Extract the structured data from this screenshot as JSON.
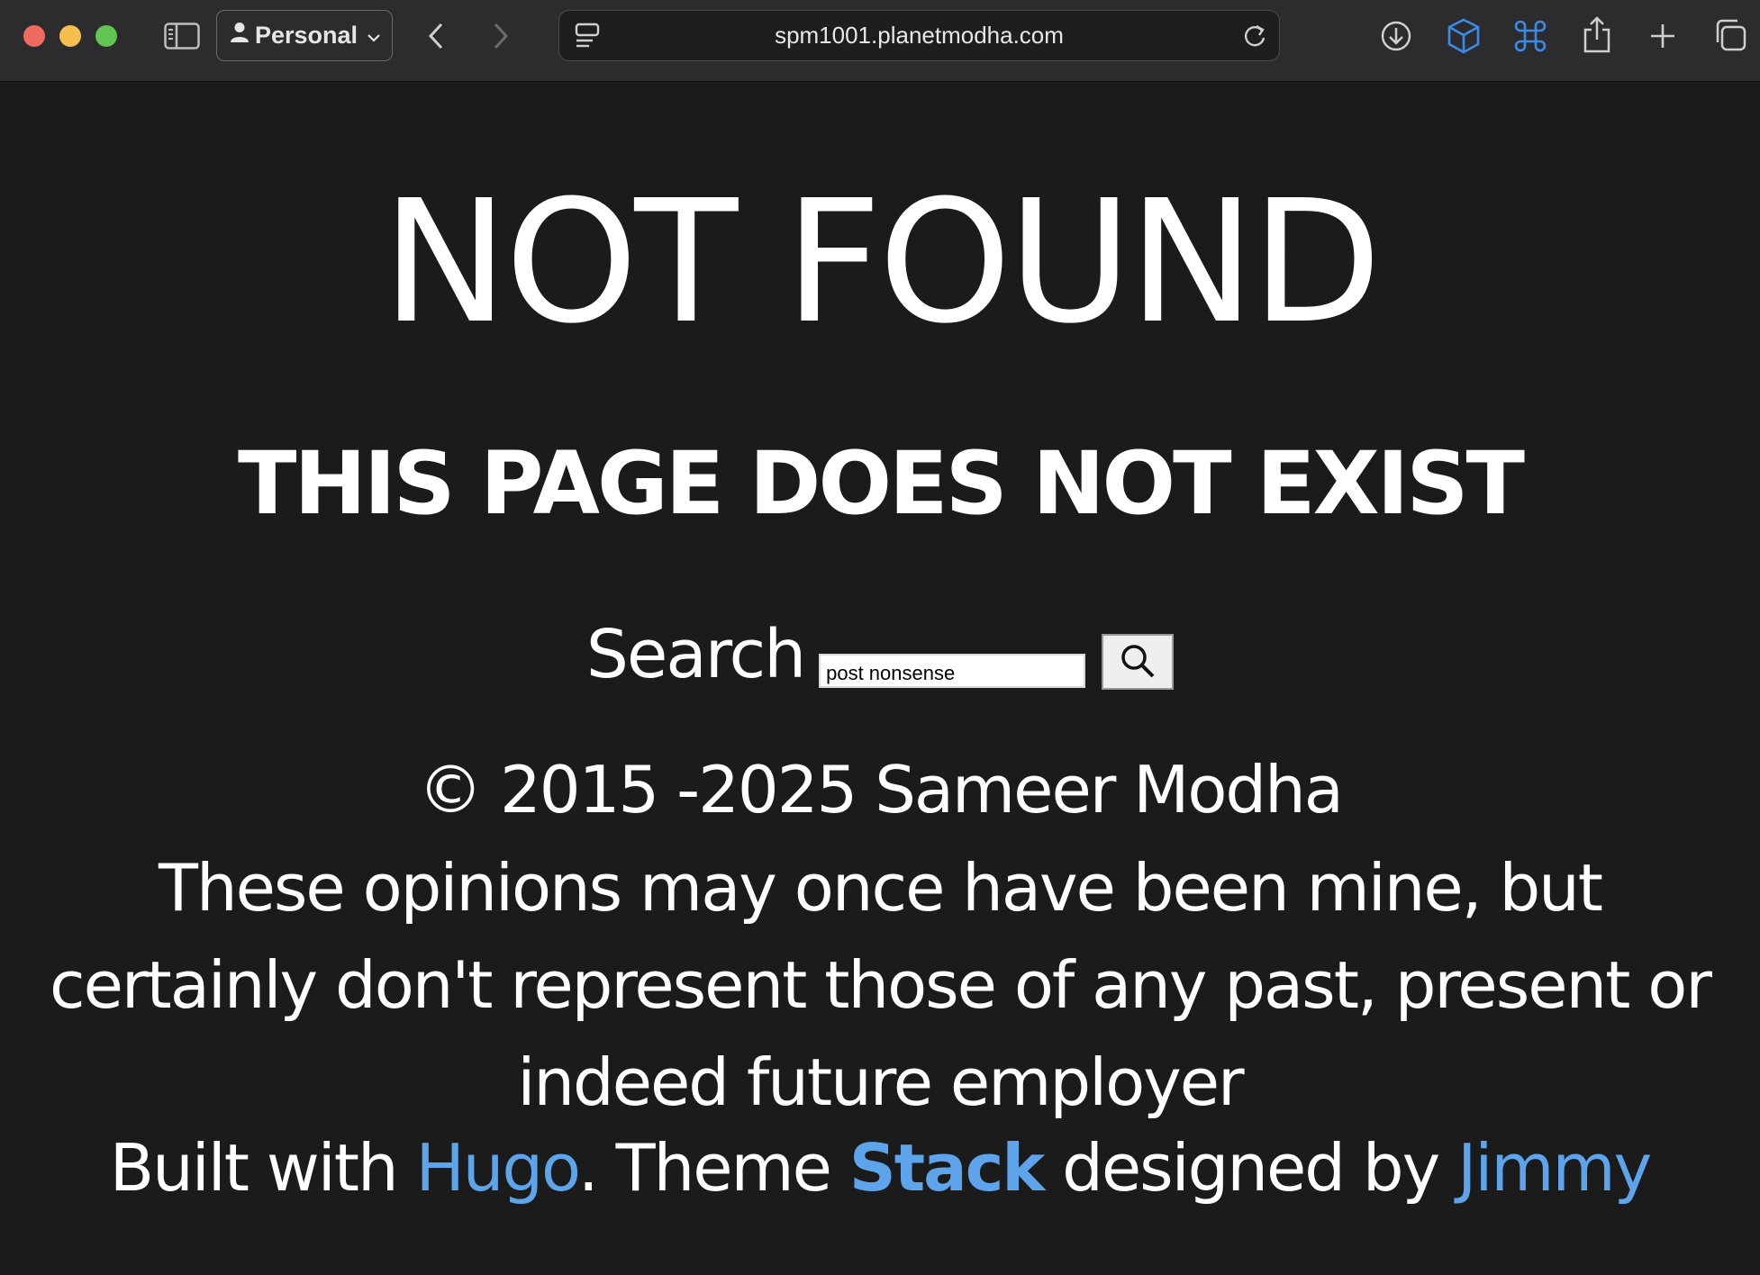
{
  "browser": {
    "profile_label": "Personal",
    "url": "spm1001.planetmodha.com",
    "icons": {
      "sidebar": "sidebar-icon",
      "back": "chevron-left-icon",
      "forward": "chevron-right-icon",
      "page_menu": "page-menu-icon",
      "reload": "reload-icon",
      "downloads": "download-icon",
      "extension_box": "cube-icon",
      "extension_cmd": "command-key-icon",
      "share": "share-icon",
      "new_tab": "plus-icon",
      "tab_overview": "tabs-overview-icon"
    },
    "accent_color": "#3a8be8"
  },
  "page": {
    "background": "#1b1b1b",
    "heading": "NOT FOUND",
    "subheading": "THIS PAGE DOES NOT EXIST",
    "search": {
      "label": "Search",
      "input_value": "post nonsense",
      "button_icon": "search-icon"
    },
    "footer": {
      "copyright": "© 2015 -2025 Sameer Modha",
      "disclaimer": "These opinions may once have been mine, but certainly don't represent those of any past, present or indeed future employer",
      "built_prefix": "Built with ",
      "built_link_hugo": "Hugo",
      "built_middle": ". Theme ",
      "built_link_stack": "Stack",
      "built_designed": " designed by ",
      "built_link_jimmy": "Jimmy",
      "link_color": "#5ea4ea"
    }
  }
}
